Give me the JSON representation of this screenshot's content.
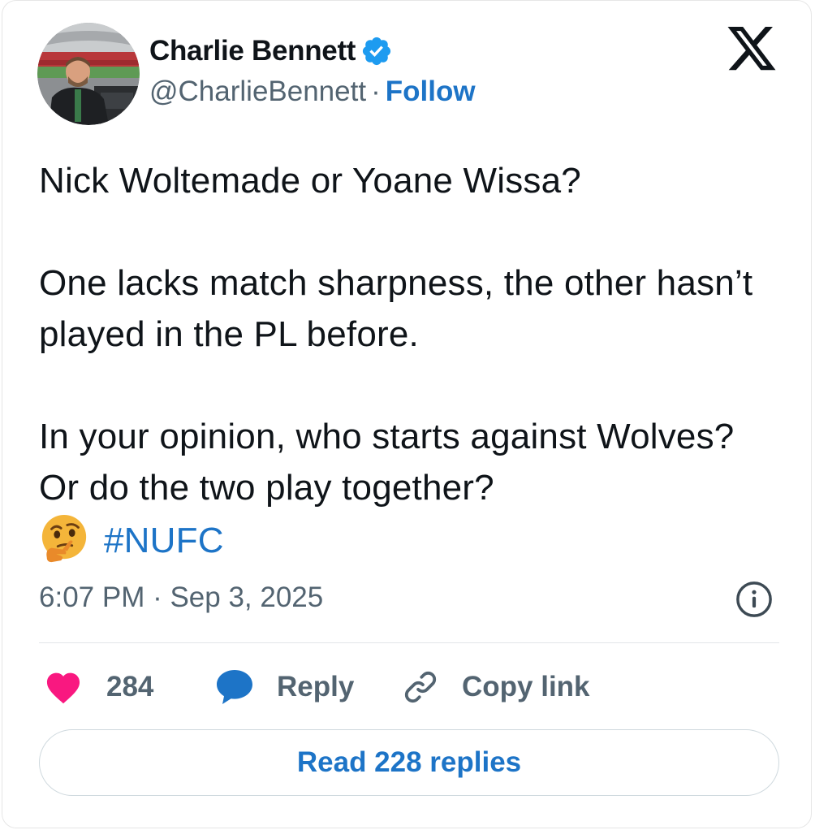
{
  "author": {
    "display_name": "Charlie Bennett",
    "handle": "@CharlieBennett",
    "separator": "·",
    "follow_label": "Follow",
    "verified": true
  },
  "tweet": {
    "paragraphs": [
      "Nick Woltemade or Yoane Wissa?",
      "One lacks match sharpness, the other hasn’t played in the PL before.",
      "In your opinion, who starts against Wolves? Or do the two play together?"
    ],
    "hashtag": "#NUFC",
    "timestamp": "6:07 PM · Sep 3, 2025"
  },
  "actions": {
    "like_count": "284",
    "reply_label": "Reply",
    "copy_link_label": "Copy link"
  },
  "read_replies_label": "Read 228 replies",
  "colors": {
    "accent_blue": "#1d74c7",
    "verified_blue": "#1d9bf0",
    "like_pink": "#f91880",
    "text_primary": "#0f1419",
    "text_secondary": "#536471"
  },
  "icons": {
    "logo": "x-logo-icon",
    "verified": "verified-badge-icon",
    "info": "info-icon",
    "like": "heart-icon",
    "reply": "speech-bubble-icon",
    "copy": "link-icon",
    "emoji": "thinking-face-icon"
  }
}
